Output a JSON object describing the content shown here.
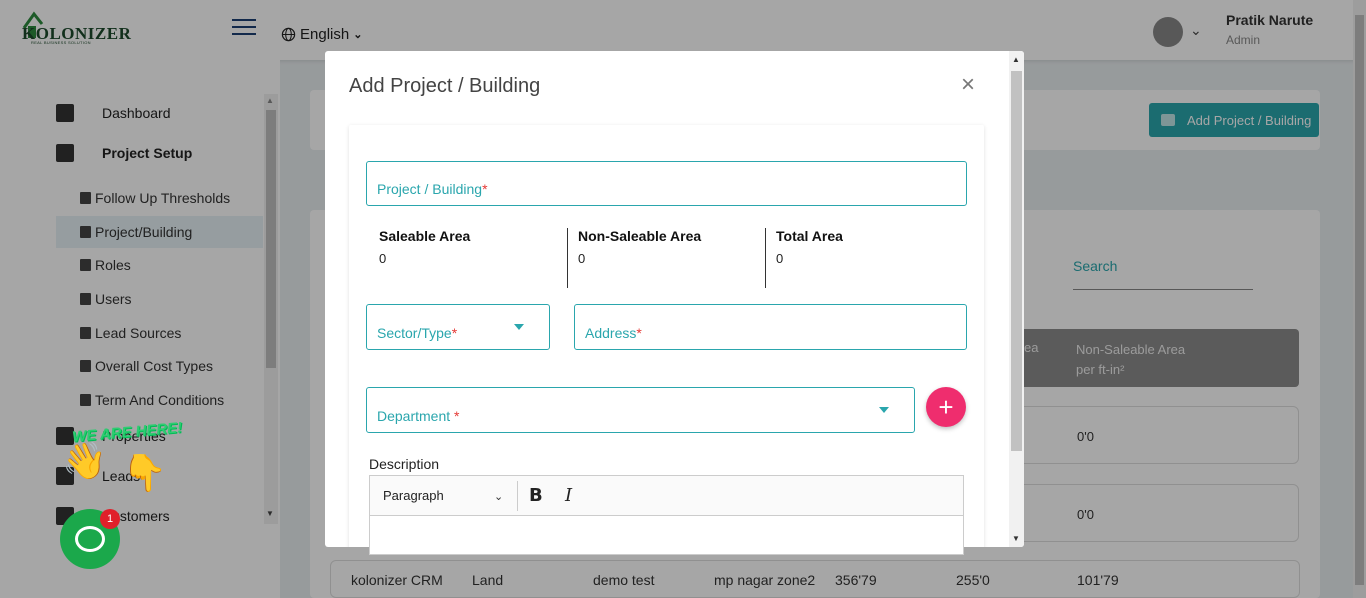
{
  "app": {
    "logo_text": "KOLONIZER",
    "logo_tagline": "REAL BUSINESS SOLUTION",
    "language": "English",
    "user_name": "Pratik Narute",
    "user_role": "Admin"
  },
  "sidebar": {
    "main_items": [
      {
        "label": "Dashboard",
        "icon": "bar-chart-icon"
      },
      {
        "label": "Project Setup",
        "icon": "clipboard-icon"
      }
    ],
    "sub_items": [
      {
        "label": "Follow Up Thresholds",
        "icon": "building-icon"
      },
      {
        "label": "Project/Building",
        "icon": "building-icon"
      },
      {
        "label": "Roles",
        "icon": "users-icon"
      },
      {
        "label": "Users",
        "icon": "user-icon"
      },
      {
        "label": "Lead Sources",
        "icon": "money-icon"
      },
      {
        "label": "Overall Cost Types",
        "icon": "money-icon"
      },
      {
        "label": "Term And Conditions",
        "icon": "document-icon"
      }
    ],
    "lower_items": [
      {
        "label": "Properties",
        "icon": "home-icon"
      },
      {
        "label": "Leads",
        "icon": "trend-icon"
      },
      {
        "label": "Customers",
        "icon": "user-icon"
      }
    ]
  },
  "main": {
    "add_button_label": "Add Project / Building",
    "search_label": "Search",
    "table_header_partial": "ea",
    "table_header_col": "Non-Saleable Area per ft-in²",
    "row_values": [
      "0'0",
      "0'0"
    ],
    "bottom_row": [
      "kolonizer CRM",
      "Land",
      "demo test",
      "mp nagar zone2",
      "356'79",
      "255'0",
      "101'79"
    ]
  },
  "chat_widget": {
    "banner": "WE ARE HERE!",
    "badge_count": "1"
  },
  "modal": {
    "title": "Add Project / Building",
    "close_symbol": "×",
    "project_field_label": "Project / Building",
    "areas": [
      {
        "label": "Saleable Area",
        "value": "0"
      },
      {
        "label": "Non-Saleable Area",
        "value": "0"
      },
      {
        "label": "Total Area",
        "value": "0"
      }
    ],
    "sector_label": "Sector/Type",
    "address_label": "Address",
    "department_label": "Department ",
    "required_mark": "*",
    "add_symbol": "+",
    "description_label": "Description",
    "editor_block_format": "Paragraph",
    "bold_label": "B",
    "italic_label": "I"
  },
  "colors": {
    "accent": "#2aa6ad",
    "add_fab": "#ef2d6e",
    "required": "#e53935",
    "chat_green": "#1ba84b"
  }
}
